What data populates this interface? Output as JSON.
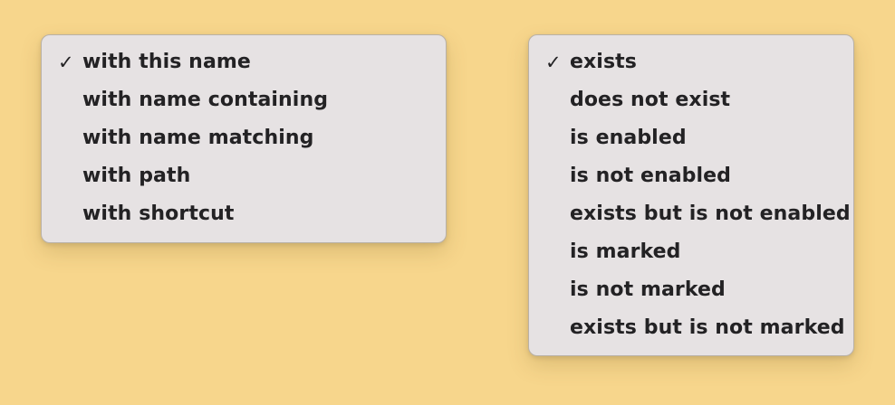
{
  "menu_left": {
    "items": [
      {
        "label": "with this name",
        "checked": true
      },
      {
        "label": "with name containing",
        "checked": false
      },
      {
        "label": "with name matching",
        "checked": false
      },
      {
        "label": "with path",
        "checked": false
      },
      {
        "label": "with shortcut",
        "checked": false
      }
    ]
  },
  "menu_right": {
    "items": [
      {
        "label": "exists",
        "checked": true
      },
      {
        "label": "does not exist",
        "checked": false
      },
      {
        "label": "is enabled",
        "checked": false
      },
      {
        "label": "is not enabled",
        "checked": false
      },
      {
        "label": "exists but is not enabled",
        "checked": false
      },
      {
        "label": "is marked",
        "checked": false
      },
      {
        "label": "is not marked",
        "checked": false
      },
      {
        "label": "exists but is not marked",
        "checked": false
      }
    ]
  },
  "check_glyph": "✓",
  "colors": {
    "background": "#f7d68c",
    "menu_background": "#e6e2e3",
    "text": "#232224"
  }
}
